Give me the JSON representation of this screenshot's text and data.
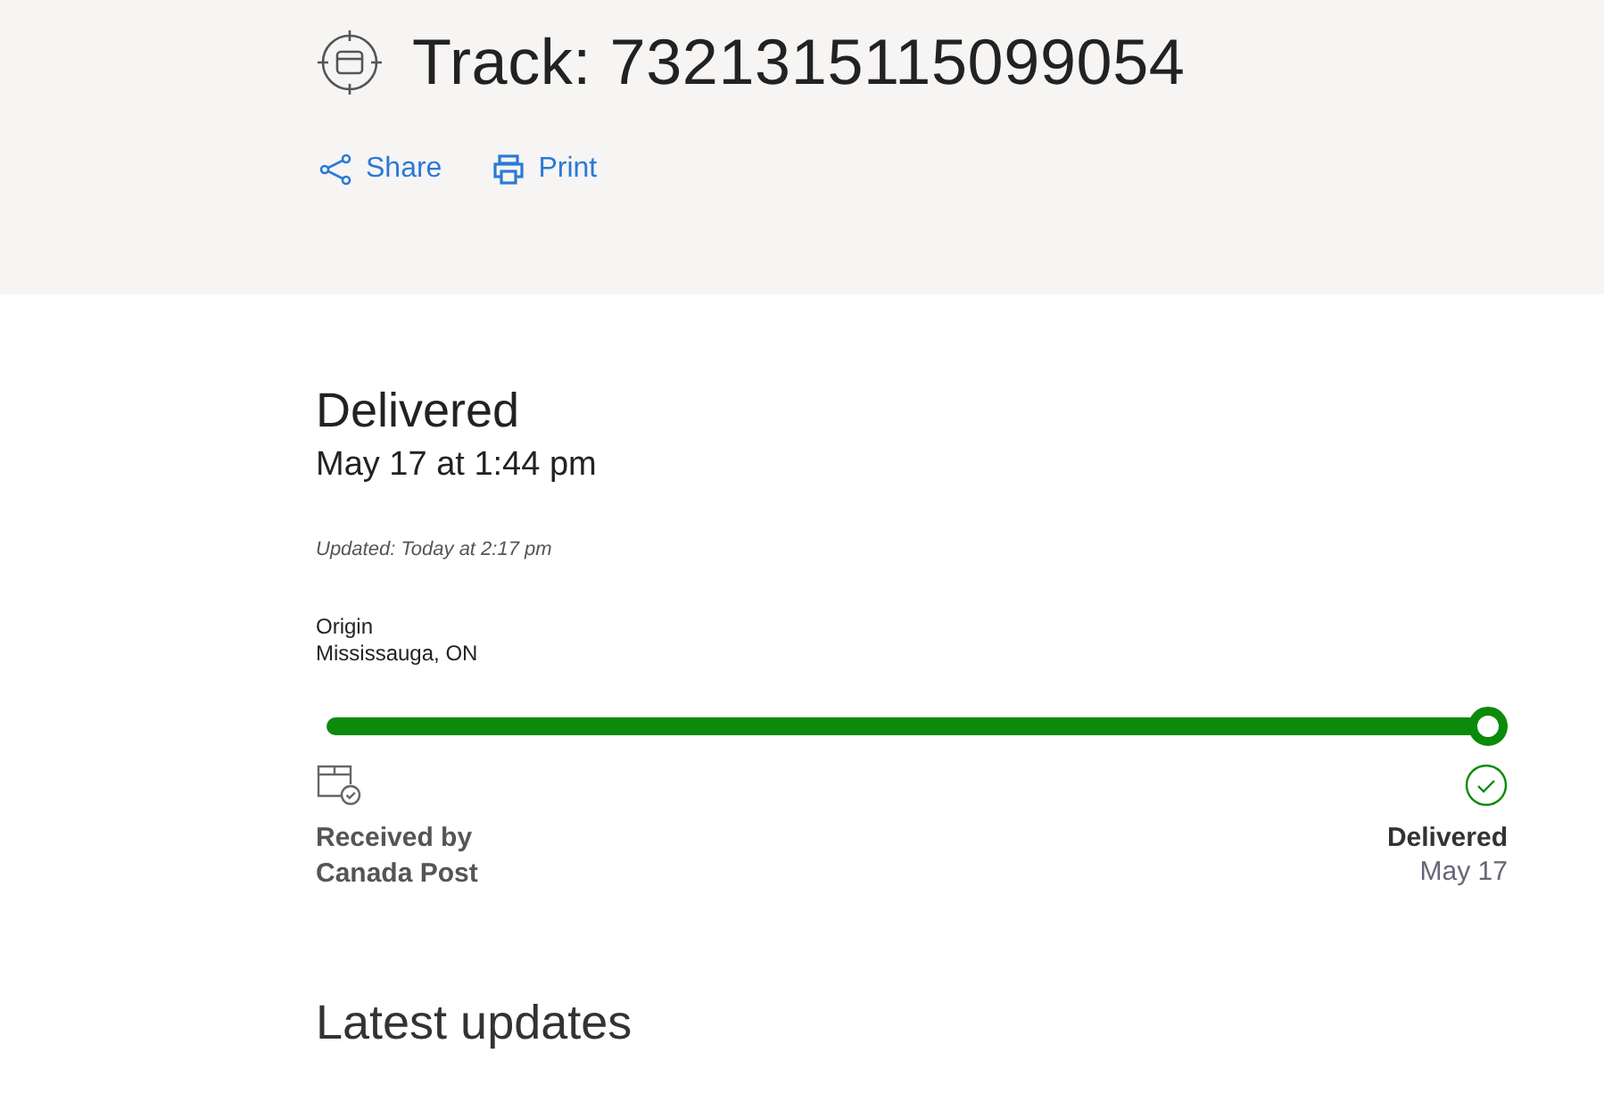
{
  "header": {
    "title": "Track: 7321315115099054",
    "actions": [
      {
        "kind": "share",
        "label": "Share"
      },
      {
        "kind": "print",
        "label": "Print"
      }
    ]
  },
  "status": {
    "title": "Delivered",
    "date": "May 17 at 1:44 pm",
    "updated": "Updated: Today at 2:17 pm"
  },
  "origin": {
    "label": "Origin",
    "place": "Mississauga, ON"
  },
  "progress": {
    "level": 1
  },
  "milestones": [
    {
      "kind": "received",
      "title": "Received by\nCanada Post"
    },
    {
      "kind": "delivered",
      "title": "Delivered",
      "date": "May 17"
    }
  ],
  "section_title": "Latest updates"
}
